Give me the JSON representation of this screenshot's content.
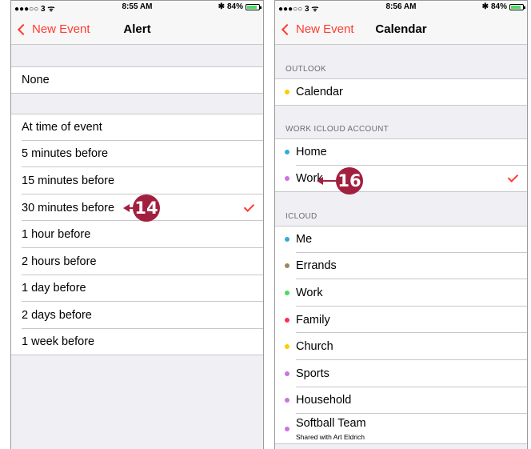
{
  "left_screen": {
    "status": {
      "signal": "●●●○○ 3 ᯤ",
      "time": "8:55 AM",
      "bluetooth": "✱",
      "battery": "84%"
    },
    "nav": {
      "back": "New Event",
      "title": "Alert"
    },
    "none_option": "None",
    "options": [
      "At time of event",
      "5 minutes before",
      "15 minutes before",
      "30 minutes before",
      "1 hour before",
      "2 hours before",
      "1 day before",
      "2 days before",
      "1 week before"
    ],
    "selected": "30 minutes before",
    "callout": "14"
  },
  "right_screen": {
    "status": {
      "signal": "●●●○○ 3 ᯤ",
      "time": "8:56 AM",
      "bluetooth": "✱",
      "battery": "84%"
    },
    "nav": {
      "back": "New Event",
      "title": "Calendar"
    },
    "sections": [
      {
        "header": "OUTLOOK",
        "items": [
          {
            "name": "Calendar",
            "color": "#ffcc00"
          }
        ]
      },
      {
        "header": "WORK ICLOUD ACCOUNT",
        "items": [
          {
            "name": "Home",
            "color": "#34aadc"
          },
          {
            "name": "Work",
            "color": "#cc73e1"
          }
        ]
      },
      {
        "header": "ICLOUD",
        "items": [
          {
            "name": "Me",
            "color": "#34aadc"
          },
          {
            "name": "Errands",
            "color": "#a2845e"
          },
          {
            "name": "Work",
            "color": "#4cd964"
          },
          {
            "name": "Family",
            "color": "#ff2d55"
          },
          {
            "name": "Church",
            "color": "#ffcc00"
          },
          {
            "name": "Sports",
            "color": "#cc73e1"
          },
          {
            "name": "Household",
            "color": "#cc73e1"
          },
          {
            "name": "Softball Team",
            "subtitle": "Shared with Art Eldrich",
            "color": "#cc73e1"
          }
        ]
      }
    ],
    "selected": "Work",
    "callout": "16"
  },
  "colors": {
    "accent": "#ff3b30",
    "callout": "#a21f3e"
  }
}
